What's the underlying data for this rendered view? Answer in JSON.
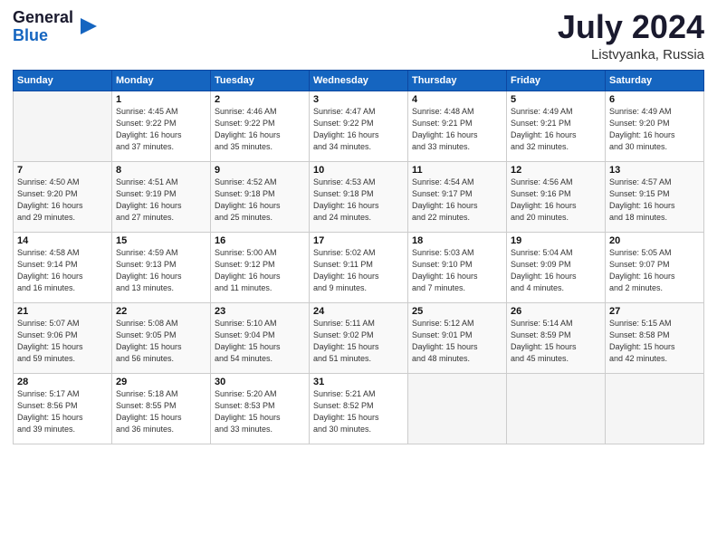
{
  "header": {
    "logo_line1": "General",
    "logo_line2": "Blue",
    "month": "July 2024",
    "location": "Listvyanka, Russia"
  },
  "days_of_week": [
    "Sunday",
    "Monday",
    "Tuesday",
    "Wednesday",
    "Thursday",
    "Friday",
    "Saturday"
  ],
  "weeks": [
    [
      {
        "day": "",
        "info": ""
      },
      {
        "day": "1",
        "info": "Sunrise: 4:45 AM\nSunset: 9:22 PM\nDaylight: 16 hours\nand 37 minutes."
      },
      {
        "day": "2",
        "info": "Sunrise: 4:46 AM\nSunset: 9:22 PM\nDaylight: 16 hours\nand 35 minutes."
      },
      {
        "day": "3",
        "info": "Sunrise: 4:47 AM\nSunset: 9:22 PM\nDaylight: 16 hours\nand 34 minutes."
      },
      {
        "day": "4",
        "info": "Sunrise: 4:48 AM\nSunset: 9:21 PM\nDaylight: 16 hours\nand 33 minutes."
      },
      {
        "day": "5",
        "info": "Sunrise: 4:49 AM\nSunset: 9:21 PM\nDaylight: 16 hours\nand 32 minutes."
      },
      {
        "day": "6",
        "info": "Sunrise: 4:49 AM\nSunset: 9:20 PM\nDaylight: 16 hours\nand 30 minutes."
      }
    ],
    [
      {
        "day": "7",
        "info": "Sunrise: 4:50 AM\nSunset: 9:20 PM\nDaylight: 16 hours\nand 29 minutes."
      },
      {
        "day": "8",
        "info": "Sunrise: 4:51 AM\nSunset: 9:19 PM\nDaylight: 16 hours\nand 27 minutes."
      },
      {
        "day": "9",
        "info": "Sunrise: 4:52 AM\nSunset: 9:18 PM\nDaylight: 16 hours\nand 25 minutes."
      },
      {
        "day": "10",
        "info": "Sunrise: 4:53 AM\nSunset: 9:18 PM\nDaylight: 16 hours\nand 24 minutes."
      },
      {
        "day": "11",
        "info": "Sunrise: 4:54 AM\nSunset: 9:17 PM\nDaylight: 16 hours\nand 22 minutes."
      },
      {
        "day": "12",
        "info": "Sunrise: 4:56 AM\nSunset: 9:16 PM\nDaylight: 16 hours\nand 20 minutes."
      },
      {
        "day": "13",
        "info": "Sunrise: 4:57 AM\nSunset: 9:15 PM\nDaylight: 16 hours\nand 18 minutes."
      }
    ],
    [
      {
        "day": "14",
        "info": "Sunrise: 4:58 AM\nSunset: 9:14 PM\nDaylight: 16 hours\nand 16 minutes."
      },
      {
        "day": "15",
        "info": "Sunrise: 4:59 AM\nSunset: 9:13 PM\nDaylight: 16 hours\nand 13 minutes."
      },
      {
        "day": "16",
        "info": "Sunrise: 5:00 AM\nSunset: 9:12 PM\nDaylight: 16 hours\nand 11 minutes."
      },
      {
        "day": "17",
        "info": "Sunrise: 5:02 AM\nSunset: 9:11 PM\nDaylight: 16 hours\nand 9 minutes."
      },
      {
        "day": "18",
        "info": "Sunrise: 5:03 AM\nSunset: 9:10 PM\nDaylight: 16 hours\nand 7 minutes."
      },
      {
        "day": "19",
        "info": "Sunrise: 5:04 AM\nSunset: 9:09 PM\nDaylight: 16 hours\nand 4 minutes."
      },
      {
        "day": "20",
        "info": "Sunrise: 5:05 AM\nSunset: 9:07 PM\nDaylight: 16 hours\nand 2 minutes."
      }
    ],
    [
      {
        "day": "21",
        "info": "Sunrise: 5:07 AM\nSunset: 9:06 PM\nDaylight: 15 hours\nand 59 minutes."
      },
      {
        "day": "22",
        "info": "Sunrise: 5:08 AM\nSunset: 9:05 PM\nDaylight: 15 hours\nand 56 minutes."
      },
      {
        "day": "23",
        "info": "Sunrise: 5:10 AM\nSunset: 9:04 PM\nDaylight: 15 hours\nand 54 minutes."
      },
      {
        "day": "24",
        "info": "Sunrise: 5:11 AM\nSunset: 9:02 PM\nDaylight: 15 hours\nand 51 minutes."
      },
      {
        "day": "25",
        "info": "Sunrise: 5:12 AM\nSunset: 9:01 PM\nDaylight: 15 hours\nand 48 minutes."
      },
      {
        "day": "26",
        "info": "Sunrise: 5:14 AM\nSunset: 8:59 PM\nDaylight: 15 hours\nand 45 minutes."
      },
      {
        "day": "27",
        "info": "Sunrise: 5:15 AM\nSunset: 8:58 PM\nDaylight: 15 hours\nand 42 minutes."
      }
    ],
    [
      {
        "day": "28",
        "info": "Sunrise: 5:17 AM\nSunset: 8:56 PM\nDaylight: 15 hours\nand 39 minutes."
      },
      {
        "day": "29",
        "info": "Sunrise: 5:18 AM\nSunset: 8:55 PM\nDaylight: 15 hours\nand 36 minutes."
      },
      {
        "day": "30",
        "info": "Sunrise: 5:20 AM\nSunset: 8:53 PM\nDaylight: 15 hours\nand 33 minutes."
      },
      {
        "day": "31",
        "info": "Sunrise: 5:21 AM\nSunset: 8:52 PM\nDaylight: 15 hours\nand 30 minutes."
      },
      {
        "day": "",
        "info": ""
      },
      {
        "day": "",
        "info": ""
      },
      {
        "day": "",
        "info": ""
      }
    ]
  ]
}
